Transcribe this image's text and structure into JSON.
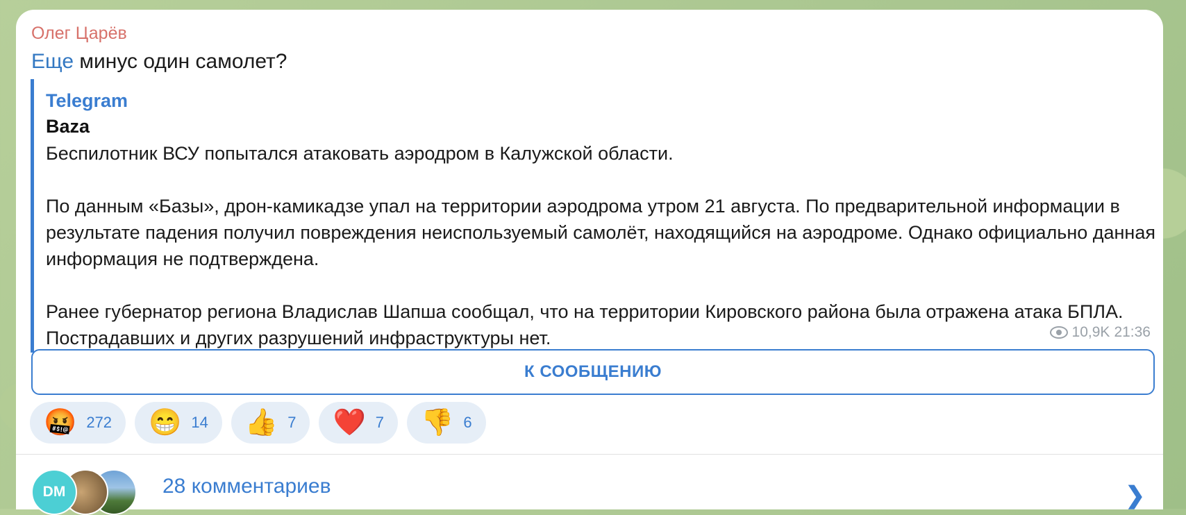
{
  "post": {
    "sender": "Олег Царёв",
    "message_link": "Еще",
    "message_rest": " минус один самолет?",
    "quote": {
      "source": "Telegram",
      "title": "Baza",
      "body": "Беспилотник ВСУ попытался атаковать аэродром в Калужской области.\n\nПо данным «Базы», дрон-камикадзе упал на территории аэродрома утром 21 августа. По предварительной информации в результате падения получил повреждения неиспользуемый самолёт, находящийся на аэродроме. Однако официально данная информация не подтверждена.\n\nРанее губернатор региона Владислав Шапша сообщал, что на территории Кировского района была отражена атака БПЛА. Пострадавших и других разрушений инфраструктуры нет."
    },
    "views": "10,9K",
    "time": "21:36",
    "button_label": "К СООБЩЕНИЮ"
  },
  "reactions": [
    {
      "icon": "swearing-face-icon",
      "emoji": "🤬",
      "count": "272"
    },
    {
      "icon": "grinning-face-icon",
      "emoji": "😁",
      "count": "14"
    },
    {
      "icon": "thumbs-up-icon",
      "emoji": "👍",
      "count": "7"
    },
    {
      "icon": "heart-icon",
      "emoji": "❤️",
      "count": "7"
    },
    {
      "icon": "thumbs-down-icon",
      "emoji": "👎",
      "count": "6"
    }
  ],
  "comments": {
    "avatar_initials": "DM",
    "label": "28 комментариев"
  },
  "colors": {
    "accent": "#3a7dd0",
    "sender": "#d7716a",
    "reaction_bg": "#e6eef7"
  }
}
